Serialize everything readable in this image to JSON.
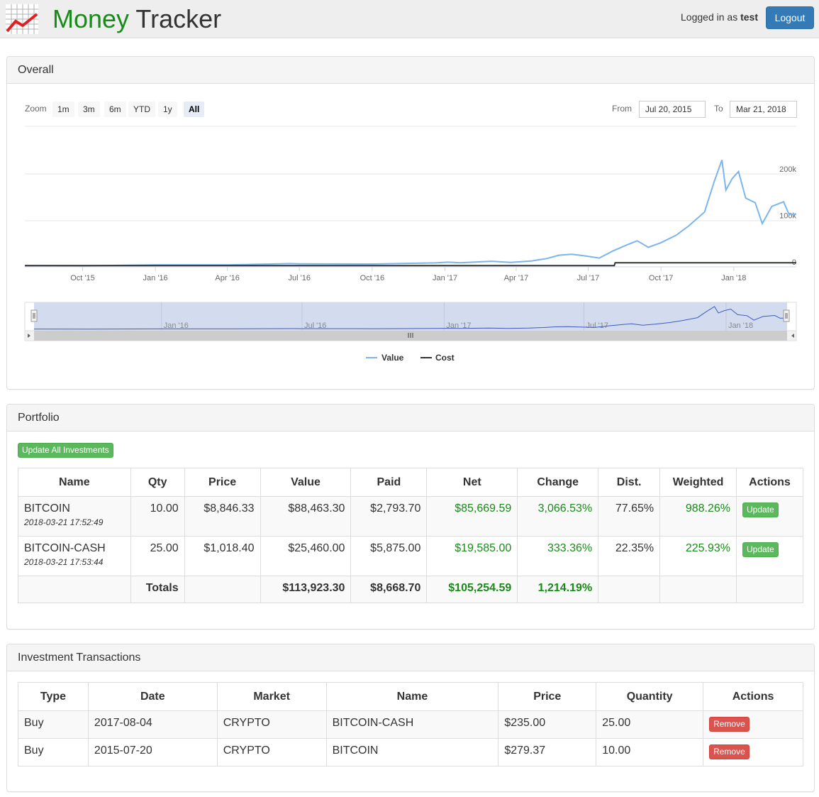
{
  "nav": {
    "brand_part1": "Money",
    "brand_part2": "Tracker",
    "logged_in_prefix": "Logged in as",
    "username": "test",
    "logout_label": "Logout"
  },
  "overall": {
    "title": "Overall",
    "zoom_label": "Zoom",
    "zoom_buttons": [
      "1m",
      "3m",
      "6m",
      "YTD",
      "1y",
      "All"
    ],
    "active_zoom": "All",
    "from_label": "From",
    "from_value": "Jul 20, 2015",
    "to_label": "To",
    "to_value": "Mar 21, 2018",
    "chart_data": {
      "type": "line",
      "x_tick_labels": [
        "Oct '15",
        "Jan '16",
        "Apr '16",
        "Jul '16",
        "Oct '16",
        "Jan '17",
        "Apr '17",
        "Jul '17",
        "Oct '17",
        "Jan '18"
      ],
      "y_tick_labels": [
        "0",
        "100k",
        "200k"
      ],
      "navigator_tick_labels": [
        "Jan '16",
        "Jul '16",
        "Jan '17",
        "Jul '17",
        "Jan '18"
      ],
      "ylim": [
        0,
        200000
      ],
      "legend_position": "bottom-center",
      "series": [
        {
          "name": "Value",
          "color": "#7cb5ec",
          "points": [
            [
              "2015-07-20",
              2794
            ],
            [
              "2015-10-01",
              2300
            ],
            [
              "2016-01-01",
              4300
            ],
            [
              "2016-04-01",
              4100
            ],
            [
              "2016-06-20",
              7000
            ],
            [
              "2016-07-01",
              6500
            ],
            [
              "2016-10-01",
              6100
            ],
            [
              "2016-12-20",
              8500
            ],
            [
              "2017-01-05",
              10000
            ],
            [
              "2017-01-20",
              8800
            ],
            [
              "2017-03-01",
              12000
            ],
            [
              "2017-03-25",
              9500
            ],
            [
              "2017-04-20",
              12500
            ],
            [
              "2017-05-10",
              18000
            ],
            [
              "2017-05-25",
              25000
            ],
            [
              "2017-06-10",
              27000
            ],
            [
              "2017-06-25",
              24000
            ],
            [
              "2017-07-15",
              19000
            ],
            [
              "2017-08-01",
              34000
            ],
            [
              "2017-08-20",
              48000
            ],
            [
              "2017-09-01",
              56000
            ],
            [
              "2017-09-15",
              42000
            ],
            [
              "2017-10-01",
              52000
            ],
            [
              "2017-10-20",
              68000
            ],
            [
              "2017-11-05",
              88000
            ],
            [
              "2017-11-25",
              118000
            ],
            [
              "2017-12-07",
              182000
            ],
            [
              "2017-12-17",
              230000
            ],
            [
              "2017-12-22",
              165000
            ],
            [
              "2017-12-30",
              190000
            ],
            [
              "2018-01-07",
              205000
            ],
            [
              "2018-01-16",
              148000
            ],
            [
              "2018-01-28",
              138000
            ],
            [
              "2018-02-06",
              93000
            ],
            [
              "2018-02-18",
              130000
            ],
            [
              "2018-03-05",
              140000
            ],
            [
              "2018-03-12",
              112000
            ],
            [
              "2018-03-21",
              113923
            ]
          ]
        },
        {
          "name": "Cost",
          "color": "#000000",
          "points": [
            [
              "2015-07-20",
              2794
            ],
            [
              "2017-08-03",
              2794
            ],
            [
              "2017-08-04",
              8669
            ],
            [
              "2018-03-21",
              8669
            ]
          ]
        }
      ]
    }
  },
  "portfolio": {
    "title": "Portfolio",
    "update_all_label": "Update All Investments",
    "columns": [
      "Name",
      "Qty",
      "Price",
      "Value",
      "Paid",
      "Net",
      "Change",
      "Dist.",
      "Weighted",
      "Actions"
    ],
    "rows": [
      {
        "name": "BITCOIN",
        "timestamp": "2018-03-21 17:52:49",
        "qty": "10.00",
        "price": "$8,846.33",
        "value": "$88,463.30",
        "paid": "$2,793.70",
        "net": "$85,669.59",
        "change": "3,066.53%",
        "dist": "77.65%",
        "weighted": "988.26%",
        "action": "Update"
      },
      {
        "name": "BITCOIN-CASH",
        "timestamp": "2018-03-21 17:53:44",
        "qty": "25.00",
        "price": "$1,018.40",
        "value": "$25,460.00",
        "paid": "$5,875.00",
        "net": "$19,585.00",
        "change": "333.36%",
        "dist": "22.35%",
        "weighted": "225.93%",
        "action": "Update"
      }
    ],
    "totals": {
      "label": "Totals",
      "value": "$113,923.30",
      "paid": "$8,668.70",
      "net": "$105,254.59",
      "change": "1,214.19%"
    }
  },
  "transactions": {
    "title": "Investment Transactions",
    "columns": [
      "Type",
      "Date",
      "Market",
      "Name",
      "Price",
      "Quantity",
      "Actions"
    ],
    "rows": [
      {
        "type": "Buy",
        "date": "2017-08-04",
        "market": "CRYPTO",
        "name": "BITCOIN-CASH",
        "price": "$235.00",
        "quantity": "25.00",
        "action": "Remove"
      },
      {
        "type": "Buy",
        "date": "2015-07-20",
        "market": "CRYPTO",
        "name": "BITCOIN",
        "price": "$279.37",
        "quantity": "10.00",
        "action": "Remove"
      }
    ]
  },
  "colors": {
    "brand_green": "#1a8a1a",
    "primary": "#337ab7",
    "success": "#5cb85c",
    "danger": "#d9534f",
    "value_line": "#7cb5ec"
  }
}
